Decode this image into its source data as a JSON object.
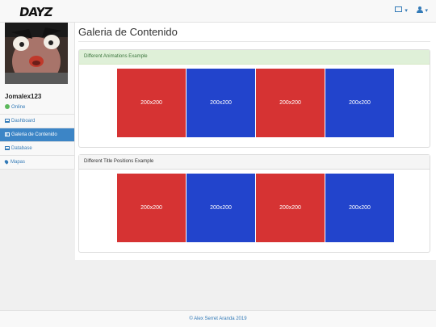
{
  "nav": {
    "logo": "DAYZ"
  },
  "user": {
    "name": "Jomalex123",
    "status": "Online"
  },
  "sidebar": {
    "items": [
      {
        "label": "Dashboard",
        "icon": "table-icon"
      },
      {
        "label": "Galeria de Contenido",
        "icon": "film-icon",
        "active": true
      },
      {
        "label": "Database",
        "icon": "table-icon"
      },
      {
        "label": "Mapas",
        "icon": "map-marker-icon"
      }
    ]
  },
  "main": {
    "title": "Galeria de Contenido",
    "panels": [
      {
        "heading": "Different Animations Example",
        "images": [
          "200x200",
          "200x200",
          "200x200",
          "200x200"
        ]
      },
      {
        "heading": "Different Title Positions Example",
        "images": [
          "200x200",
          "200x200",
          "200x200",
          "200x200"
        ]
      }
    ]
  },
  "footer": {
    "text": "© Alex Serret Aranda  2019"
  },
  "colors": {
    "red_tile": "#d63333",
    "blue_tile": "#2244cc",
    "active_menu": "#3c85c6",
    "link": "#337ab7"
  }
}
